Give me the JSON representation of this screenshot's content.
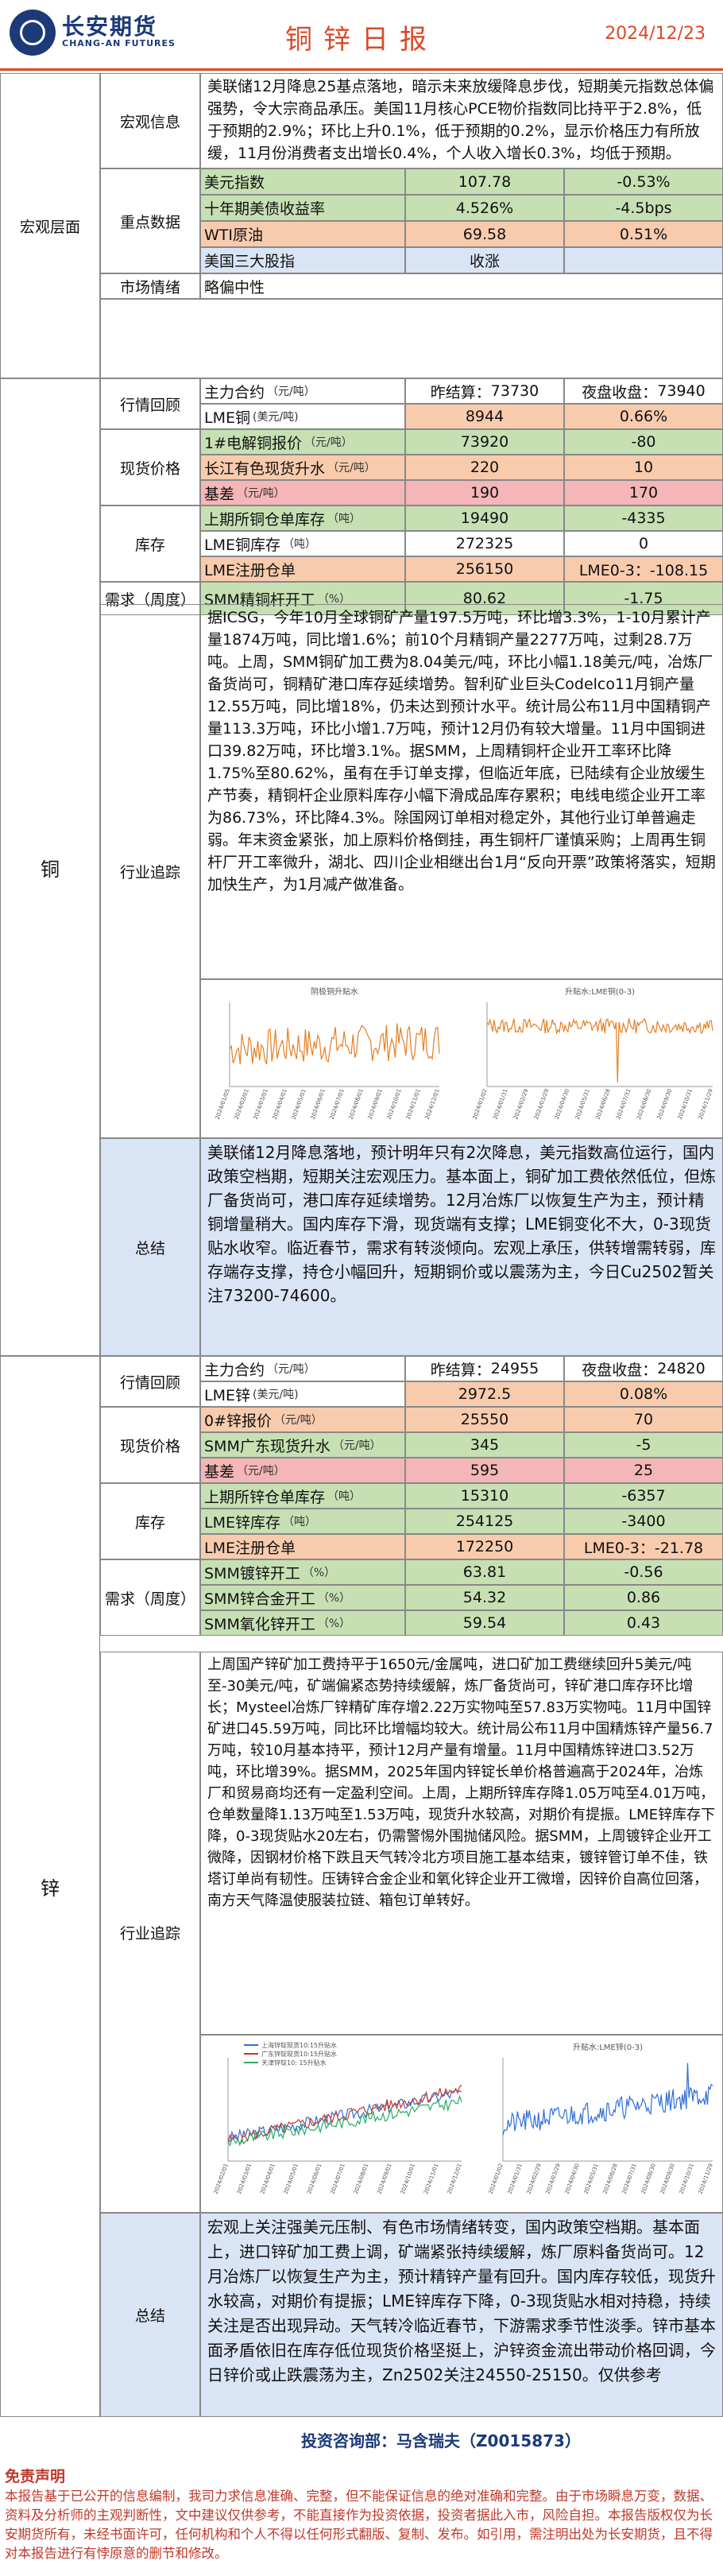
{
  "header": {
    "logo_cn": "长安期货",
    "logo_en": "CHANG-AN FUTURES",
    "title": "铜锌日报",
    "date": "2024/12/23"
  },
  "macro": {
    "section": "宏观层面",
    "info_label": "宏观信息",
    "info_text": "美联储12月降息25基点落地，暗示未来放缓降息步伐，短期美元指数总体偏强势，令大宗商品承压。美国11月核心PCE物价指数同比持平于2.8%，低于预期的2.9%；环比上升0.1%，低于预期的0.2%，显示价格压力有所放缓，11月份消费者支出增长0.4%，个人收入增长0.3%，均低于预期。",
    "key_label": "重点数据",
    "rows": [
      {
        "name": "美元指数",
        "value": "107.78",
        "change": "-0.53%"
      },
      {
        "name": "十年期美债收益率",
        "value": "4.526%",
        "change": "-4.5bps"
      },
      {
        "name": "WTI原油",
        "value": "69.58",
        "change": "0.51%"
      },
      {
        "name": "美国三大股指",
        "value": "收涨",
        "change": ""
      }
    ],
    "sentiment_label": "市场情绪",
    "sentiment_value": "略偏中性"
  },
  "copper": {
    "section": "铜",
    "quote_label": "行情回顾",
    "contract_label": "主力合约",
    "contract_unit": "（元/吨）",
    "close_label": "昨结算：",
    "close": "73730",
    "night_label": "夜盘收盘：",
    "night": "73940",
    "lme_label": "LME铜",
    "lme_unit": "(美元/吨)",
    "lme_value": "8944",
    "lme_change": "0.66%",
    "spot_label": "现货价格",
    "spot_rows": [
      {
        "name": "1#电解铜报价",
        "unit": "（元/吨）",
        "value": "73920",
        "change": "-80"
      },
      {
        "name": "长江有色现货升水",
        "unit": "（元/吨）",
        "value": "220",
        "change": "10"
      },
      {
        "name": "基差",
        "unit": "（元/吨）",
        "value": "190",
        "change": "170"
      }
    ],
    "stock_label": "库存",
    "stock_rows": [
      {
        "name": "上期所铜仓单库存",
        "unit": "（吨）",
        "value": "19490",
        "change": "-4335"
      },
      {
        "name": "LME铜库存",
        "unit": "（吨）",
        "value": "272325",
        "change": "0"
      },
      {
        "name": "LME注册仓单",
        "unit": "",
        "value": "256150",
        "change": "LME0-3：-108.15"
      }
    ],
    "demand_label": "需求（周度）",
    "demand_rows": [
      {
        "name": "SMM精铜杆开工",
        "unit": "（%）",
        "value": "80.62",
        "change": "-1.75"
      }
    ],
    "industry_label": "行业追踪",
    "industry_text": "据ICSG，今年10月全球铜矿产量197.5万吨，环比增3.3%，1-10月累计产量1874万吨，同比增1.6%；前10个月精铜产量2277万吨，过剩28.7万吨。上周，SMM铜矿加工费为8.04美元/吨，环比小幅1.18美元/吨，冶炼厂备货尚可，铜精矿港口库存延续增势。智利矿业巨头Codelco11月铜产量12.55万吨，同比增18%，仍未达到预计水平。统计局公布11月中国精铜产量113.3万吨，环比小增1.7万吨，预计12月仍有较大增量。11月中国铜进口39.82万吨，环比增3.1%。据SMM，上周精铜杆企业开工率环比降1.75%至80.62%，虽有在手订单支撑，但临近年底，已陆续有企业放缓生产节奏，精铜杆企业原料库存小幅下滑成品库存累积；电线电缆企业开工率为86.73%，环比降4.3%。除国网订单相对稳定外，其他行业订单普遍走弱。年末资金紧张，加上原料价格倒挂，再生铜杆厂谨慎采购；上周再生铜杆厂开工率微升，湖北、四川企业相继出台1月“反向开票”政策将落实，短期加快生产，为1月减产做准备。",
    "chart1_title": "阴极铜升贴水",
    "chart2_title": "升贴水:LME铜(0-3)",
    "chart1_x": [
      "2024/01/05",
      "2024/02/01",
      "2024/03/01",
      "2024/04/01",
      "2024/05/01",
      "2024/06/01",
      "2024/07/01",
      "2024/08/01",
      "2024/09/01",
      "2024/10/01",
      "2024/11/01",
      "2024/12/01"
    ],
    "chart2_x": [
      "2024/01/02",
      "2024/01/31",
      "2024/02/29",
      "2024/03/29",
      "2024/04/30",
      "2024/05/31",
      "2024/06/28",
      "2024/07/31",
      "2024/08/30",
      "2024/09/30",
      "2024/10/31",
      "2024/11/29"
    ],
    "summary_label": "总结",
    "summary_text": "美联储12月降息落地，预计明年只有2次降息，美元指数高位运行，国内政策空档期，短期关注宏观压力。基本面上，铜矿加工费依然低位，但炼厂备货尚可，港口库存延续增势。12月冶炼厂以恢复生产为主，预计精铜增量稍大。国内库存下滑，现货端有支撑；LME铜变化不大，0-3现货贴水收窄。临近春节，需求有转淡倾向。宏观上承压，供转增需转弱，库存端存支撑，持仓小幅回升，短期铜价或以震荡为主，今日Cu2502暂关注73200-74600。"
  },
  "zinc": {
    "section": "锌",
    "quote_label": "行情回顾",
    "contract_label": "主力合约",
    "contract_unit": "（元/吨）",
    "close_label": "昨结算：",
    "close": "24955",
    "night_label": "夜盘收盘：",
    "night": "24820",
    "lme_label": "LME锌",
    "lme_unit": "(美元/吨)",
    "lme_value": "2972.5",
    "lme_change": "0.08%",
    "spot_label": "现货价格",
    "spot_rows": [
      {
        "name": "0#锌报价",
        "unit": "（元/吨）",
        "value": "25550",
        "change": "70"
      },
      {
        "name": "SMM广东现货升水",
        "unit": "（元/吨）",
        "value": "345",
        "change": "-5"
      },
      {
        "name": "基差",
        "unit": "（元/吨）",
        "value": "595",
        "change": "25"
      }
    ],
    "stock_label": "库存",
    "stock_rows": [
      {
        "name": "上期所锌仓单库存",
        "unit": "（吨）",
        "value": "15310",
        "change": "-6357"
      },
      {
        "name": "LME锌库存",
        "unit": "（吨）",
        "value": "254125",
        "change": "-3400"
      },
      {
        "name": "LME注册仓单",
        "unit": "",
        "value": "172250",
        "change": "LME0-3：-21.78"
      }
    ],
    "demand_label": "需求（周度）",
    "demand_rows": [
      {
        "name": "SMM镀锌开工",
        "unit": "（%）",
        "value": "63.81",
        "change": "-0.56"
      },
      {
        "name": "SMM锌合金开工",
        "unit": "（%）",
        "value": "54.32",
        "change": "0.86"
      },
      {
        "name": "SMM氧化锌开工",
        "unit": "（%）",
        "value": "59.54",
        "change": "0.43"
      }
    ],
    "industry_label": "行业追踪",
    "industry_text": "上周国产锌矿加工费持平于1650元/金属吨，进口矿加工费继续回升5美元/吨至-30美元/吨，矿端偏紧态势持续缓解，炼厂备货尚可，锌矿港口库存环比增长；Mysteel冶炼厂锌精矿库存增2.22万实物吨至57.83万实物吨。11月中国锌矿进口45.59万吨，同比环比增幅均较大。统计局公布11月中国精炼锌产量56.7万吨，较10月基本持平，预计12月产量有增量。11月中国精炼锌进口3.52万吨，环比增39%。据SMM，2025年国内锌锭长单价格普遍高于2024年，冶炼厂和贸易商均还有一定盈利空间。上周，上期所锌库存降1.05万吨至4.01万吨，仓单数量降1.13万吨至1.53万吨，现货升水较高，对期价有提振。LME锌库存下降，0-3现货贴水20左右，仍需警惕外围抛储风险。据SMM，上周镀锌企业开工微降，因钢材价格下跌且天气转冷北方项目施工基本结束，镀锌管订单不佳，铁塔订单尚有韧性。压铸锌合金企业和氧化锌企业开工微增，因锌价自高位回落，南方天气降温使服装拉链、箱包订单转好。",
    "chart1_legend": [
      "上海锌锭现货10:15升贴水",
      "广东锌锭现货10:15升贴水",
      "天津锌锭10: 15升贴水"
    ],
    "chart2_title": "升贴水:LME锌(0-3)",
    "chart1_x": [
      "2024/02/01",
      "2024/03/01",
      "2024/04/01",
      "2024/05/01",
      "2024/06/01",
      "2024/07/01",
      "2024/08/01",
      "2024/09/01",
      "2024/10/01",
      "2024/11/01",
      "2024/12/01"
    ],
    "chart2_x": [
      "2024/01/02",
      "2024/01/31",
      "2024/02/29",
      "2024/03/29",
      "2024/04/30",
      "2024/05/31",
      "2024/06/28",
      "2024/07/31",
      "2024/08/30",
      "2024/09/30",
      "2024/10/31",
      "2024/11/29"
    ],
    "summary_label": "总结",
    "summary_text": "宏观上关注强美元压制、有色市场情绪转变，国内政策空档期。基本面上，进口锌矿加工费上调，矿端紧张持续缓解，炼厂原料备货尚可。12月冶炼厂以恢复生产为主，预计精锌产量有回升。国内库存较低，现货升水较高，对期价有提振；LME锌库存下降，0-3现货贴水相对持稳，持续关注是否出现异动。天气转冷临近春节，下游需求季节性淡季。锌市基本面矛盾依旧在库存低位现货价格坚挺上，沪锌资金流出带动价格回调，今日锌价或止跌震荡为主，Zn2502关注24550-25150。仅供参考"
  },
  "footer": {
    "consultant": "投资咨询部：马含瑞夫（Z0015873）",
    "disclaimer_title": "免责声明",
    "disclaimer": "本报告基于已公开的信息编制，我司力求信息准确、完整，但不能保证信息的绝对准确和完整。由于市场瞬息万变，数据、资料及分析师的主观判断性，文中建议仅供参考，不能直接作为投资依据，投资者据此入市，风险自担。本报告版权仅为长安期货所有，未经书面许可，任何机构和个人不得以任何形式翻版、复制、发布。如引用，需注明出处为长安期货，且不得对本报告进行有悖原意的删节和修改。"
  }
}
